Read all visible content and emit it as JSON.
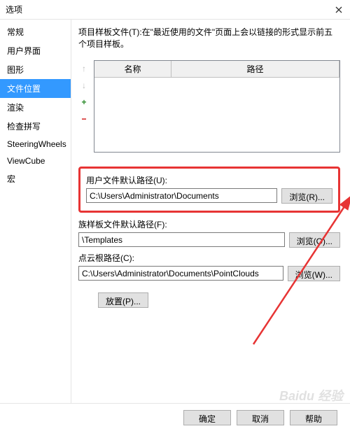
{
  "window": {
    "title": "选项"
  },
  "sidebar": {
    "items": [
      {
        "label": "常规"
      },
      {
        "label": "用户界面"
      },
      {
        "label": "图形"
      },
      {
        "label": "文件位置"
      },
      {
        "label": "渲染"
      },
      {
        "label": "检查拼写"
      },
      {
        "label": "SteeringWheels"
      },
      {
        "label": "ViewCube"
      },
      {
        "label": "宏"
      }
    ],
    "active_index": 3
  },
  "description": "项目样板文件(T):在\"最近使用的文件\"页面上会以链接的形式显示前五个项目样板。",
  "table": {
    "col_name": "名称",
    "col_path": "路径",
    "controls": {
      "move_up": "↑",
      "move_down": "↓",
      "add": "+",
      "delete": "−"
    }
  },
  "user_file_default": {
    "label": "用户文件默认路径(U):",
    "value": "C:\\Users\\Administrator\\Documents",
    "browse": "浏览(R)..."
  },
  "family_template_default": {
    "label": "族样板文件默认路径(F):",
    "value": "\\Templates",
    "browse": "浏览(O)..."
  },
  "pointcloud_root": {
    "label": "点云根路径(C):",
    "value": "C:\\Users\\Administrator\\Documents\\PointClouds",
    "browse": "浏览(W)..."
  },
  "place": "放置(P)...",
  "footer": {
    "ok": "确定",
    "cancel": "取消",
    "help": "帮助"
  },
  "watermark": "Baidu 经验",
  "annotations": {
    "highlight_color": "#e73434",
    "arrow_color": "#e73434"
  }
}
